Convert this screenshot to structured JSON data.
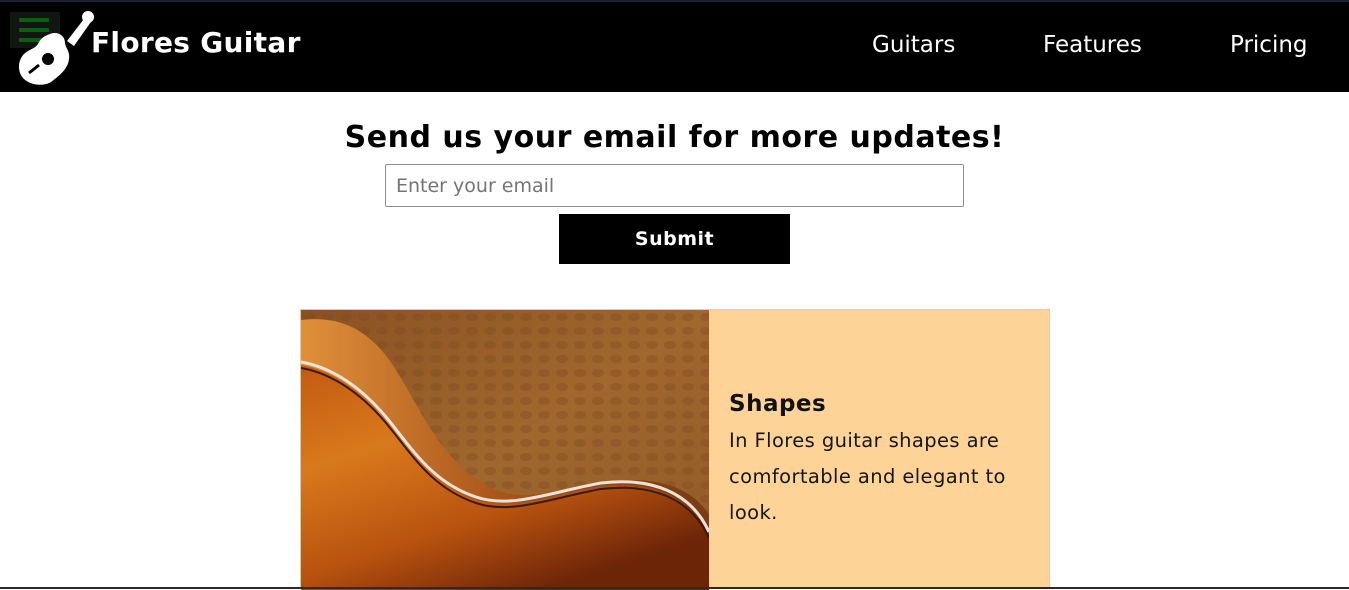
{
  "header": {
    "brand": "Flores Guitar",
    "menu_icon": "hamburger-menu-icon",
    "logo_icon": "guitar-icon",
    "nav": [
      {
        "label": "Guitars"
      },
      {
        "label": "Features"
      },
      {
        "label": "Pricing"
      }
    ]
  },
  "signup": {
    "headline": "Send us your email for more updates!",
    "email_value": "",
    "email_placeholder": "Enter your email",
    "submit_label": "Submit"
  },
  "feature": {
    "title": "Shapes",
    "description": "In Flores guitar shapes are comfortable and elegant to look.",
    "image_subject": "guitar-body-closeup"
  },
  "colors": {
    "header_bg": "#000000",
    "card_bg": "#fed397",
    "button_bg": "#000000",
    "menu_icon": "#0b5f10"
  }
}
